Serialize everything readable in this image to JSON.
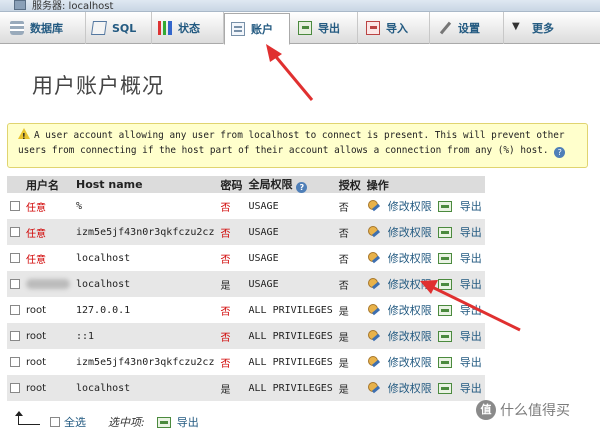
{
  "window": {
    "server_label": "服务器: localhost"
  },
  "tabs": [
    {
      "label": "数据库",
      "icon": "database-icon",
      "active": false
    },
    {
      "label": "SQL",
      "icon": "sql-icon",
      "active": false
    },
    {
      "label": "状态",
      "icon": "status-icon",
      "active": false
    },
    {
      "label": "账户",
      "icon": "users-icon",
      "active": true
    },
    {
      "label": "导出",
      "icon": "export-icon",
      "active": false
    },
    {
      "label": "导入",
      "icon": "import-icon",
      "active": false
    },
    {
      "label": "设置",
      "icon": "settings-icon",
      "active": false
    },
    {
      "label": "更多",
      "icon": "chevron-down-icon",
      "active": false
    }
  ],
  "page": {
    "title": "用户账户概况"
  },
  "warning": {
    "line1": "A user account allowing any user from localhost to connect is present. This will prevent other",
    "line2": "users from connecting if the host part of their account allows a connection from any (%) host."
  },
  "table": {
    "headers": {
      "user": "用户名",
      "host": "Host name",
      "password": "密码",
      "global_privs": "全局权限",
      "grant": "授权",
      "action": "操作"
    },
    "edit_label": "修改权限",
    "export_label": "导出",
    "rows": [
      {
        "user": "任意",
        "user_red": true,
        "host": "%",
        "password": "否",
        "password_red": true,
        "privs": "USAGE",
        "grant": "否"
      },
      {
        "user": "任意",
        "user_red": true,
        "host": "izm5e5jf43n0r3qkfczu2cz",
        "password": "否",
        "password_red": true,
        "privs": "USAGE",
        "grant": "否"
      },
      {
        "user": "任意",
        "user_red": true,
        "host": "localhost",
        "password": "否",
        "password_red": true,
        "privs": "USAGE",
        "grant": "否"
      },
      {
        "user": "",
        "user_red": false,
        "host": "localhost",
        "password": "是",
        "password_red": false,
        "privs": "USAGE",
        "grant": "否",
        "blurred_user": true
      },
      {
        "user": "root",
        "user_red": false,
        "host": "127.0.0.1",
        "password": "否",
        "password_red": true,
        "privs": "ALL PRIVILEGES",
        "grant": "是"
      },
      {
        "user": "root",
        "user_red": false,
        "host": "::1",
        "password": "否",
        "password_red": true,
        "privs": "ALL PRIVILEGES",
        "grant": "是"
      },
      {
        "user": "root",
        "user_red": false,
        "host": "izm5e5jf43n0r3qkfczu2cz",
        "password": "否",
        "password_red": true,
        "privs": "ALL PRIVILEGES",
        "grant": "是"
      },
      {
        "user": "root",
        "user_red": false,
        "host": "localhost",
        "password": "是",
        "password_red": false,
        "privs": "ALL PRIVILEGES",
        "grant": "是"
      }
    ]
  },
  "footer": {
    "select_all": "全选",
    "with_selected": "选中项:",
    "export": "导出"
  },
  "watermark": {
    "text": "什么值得买",
    "logo_char": "值"
  },
  "colors": {
    "annotation_arrow": "#e03030",
    "link": "#235a81",
    "warning_bg": "#ffffcc",
    "red_value": "#d00000"
  }
}
